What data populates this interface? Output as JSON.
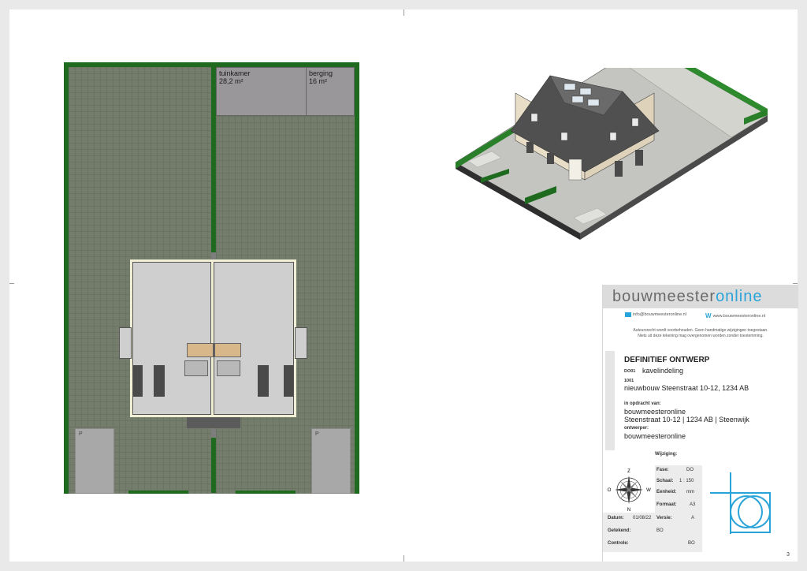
{
  "plan": {
    "shed_left": {
      "name": "tuinkamer",
      "area": "28,2 m²"
    },
    "shed_right": {
      "name": "berging",
      "area": "16 m²"
    },
    "parking_left": "P",
    "parking_right": "P"
  },
  "brand": {
    "part1": "bouwmeester",
    "part2": "online"
  },
  "contact": {
    "email": "info@bouwmeesteronline.nl",
    "web": "www.bouwmeesteronline.nl"
  },
  "disclaimer": "Auteursrecht wordt voorbehouden. Geen handmatige wijzigingen toegestaan.\nNiets uit deze tekening mag overgenomen worden zonder toestemming.",
  "drawing": {
    "title": "DEFINITIEF ONTWERP",
    "code1": "DO01",
    "subject": "kavelindeling",
    "code2": "1001",
    "project": "nieuwbouw Steenstraat 10-12, 1234 AB",
    "client_label": "in opdracht van:",
    "client_name": "bouwmeesteronline",
    "client_address": "Steenstraat 10-12 | 1234 AB | Steenwijk",
    "designer_label": "ontwerper:",
    "designer_name": "bouwmeesteronline"
  },
  "meta": {
    "change_label": "Wijziging:",
    "phase_label": "Fase:",
    "phase": "DO",
    "scale_label": "Schaal:",
    "scale": "1 : 150",
    "unit_label": "Eenheid:",
    "unit": "mm",
    "format_label": "Formaat:",
    "format": "A3",
    "date_label": "Datum:",
    "date": "01/08/22",
    "version_label": "Versie:",
    "version": "A",
    "drawn_label": "Getekend:",
    "drawn": "BO",
    "check_label": "Controle:",
    "check": "BO"
  },
  "compass": {
    "n": "Z",
    "s": "N",
    "w": "O",
    "e": "W"
  },
  "page_number": "3",
  "colors": {
    "hedge": "#1e6a1e",
    "accent": "#2aa4d8",
    "brand_text": "#6b6b6b"
  }
}
